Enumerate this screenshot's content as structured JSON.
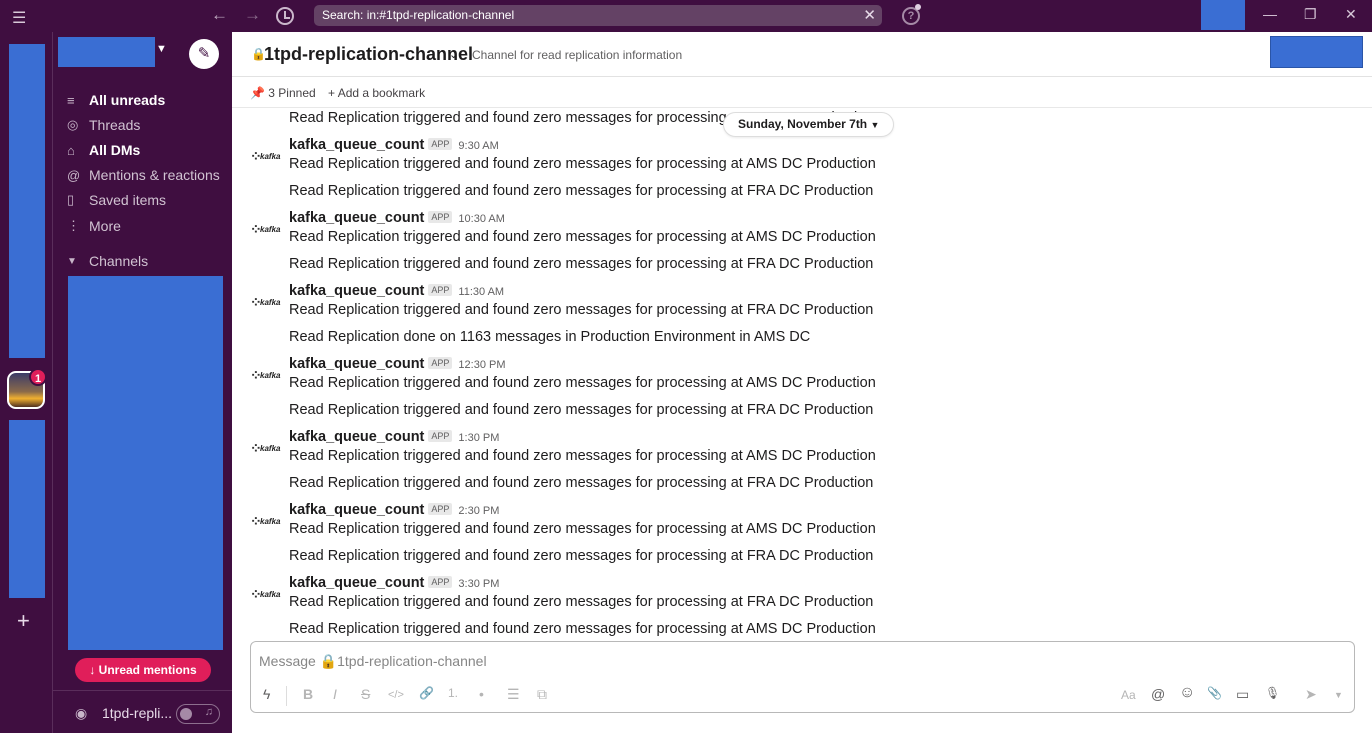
{
  "titlebar": {
    "menu_icon": "hamburger-icon",
    "search_text": "Search: in:#1tpd-replication-channel",
    "help_icon": "?"
  },
  "rail": {
    "workspace_badge": "1"
  },
  "sidebar": {
    "items": [
      {
        "label": "All unreads",
        "icon": "≡",
        "bold": true
      },
      {
        "label": "Threads",
        "icon": "◎",
        "bold": false
      },
      {
        "label": "All DMs",
        "icon": "⌂",
        "bold": true
      },
      {
        "label": "Mentions & reactions",
        "icon": "@",
        "bold": false
      },
      {
        "label": "Saved items",
        "icon": "▯",
        "bold": false
      },
      {
        "label": "More",
        "icon": "⋮",
        "bold": false
      }
    ],
    "channels_label": "Channels",
    "unread_mentions": "Unread mentions",
    "footer_channel": "1tpd-repli..."
  },
  "channel": {
    "name": "1tpd-replication-channel",
    "topic": "Channel for read replication information",
    "pinned": "3 Pinned",
    "add_bookmark": "Add a bookmark",
    "date_divider": "Sunday, November 7th"
  },
  "messages": {
    "top_partial": "Read Replication triggered and found zero messages for processing at FRA DC Production",
    "groups": [
      {
        "author": "kafka_queue_count",
        "badge": "APP",
        "time": "9:30 AM",
        "lines": [
          "Read Replication triggered and found zero messages for processing at AMS DC Production",
          "Read Replication triggered and found zero messages for processing at FRA DC Production"
        ]
      },
      {
        "author": "kafka_queue_count",
        "badge": "APP",
        "time": "10:30 AM",
        "lines": [
          "Read Replication triggered and found zero messages for processing at AMS DC Production",
          "Read Replication triggered and found zero messages for processing at FRA DC Production"
        ]
      },
      {
        "author": "kafka_queue_count",
        "badge": "APP",
        "time": "11:30 AM",
        "lines": [
          "Read Replication triggered and found zero messages for processing at FRA DC Production",
          "Read Replication done on 1163 messages in Production Environment in AMS DC"
        ]
      },
      {
        "author": "kafka_queue_count",
        "badge": "APP",
        "time": "12:30 PM",
        "lines": [
          "Read Replication triggered and found zero messages for processing at AMS DC Production",
          "Read Replication triggered and found zero messages for processing at FRA DC Production"
        ]
      },
      {
        "author": "kafka_queue_count",
        "badge": "APP",
        "time": "1:30 PM",
        "lines": [
          "Read Replication triggered and found zero messages for processing at AMS DC Production",
          "Read Replication triggered and found zero messages for processing at FRA DC Production"
        ]
      },
      {
        "author": "kafka_queue_count",
        "badge": "APP",
        "time": "2:30 PM",
        "lines": [
          "Read Replication triggered and found zero messages for processing at AMS DC Production",
          "Read Replication triggered and found zero messages for processing at FRA DC Production"
        ]
      },
      {
        "author": "kafka_queue_count",
        "badge": "APP",
        "time": "3:30 PM",
        "lines": [
          "Read Replication triggered and found zero messages for processing at FRA DC Production",
          "Read Replication triggered and found zero messages for processing at AMS DC Production"
        ]
      }
    ],
    "avatar_text": "kafka"
  },
  "composer": {
    "placeholder": "Message 🔒1tpd-replication-channel",
    "format_buttons": [
      "B",
      "I",
      "S",
      "</>",
      "🔗",
      "1.",
      "•",
      "☰",
      "⧉"
    ],
    "right_buttons": [
      "Aa",
      "@",
      "☺",
      "📎",
      "▭",
      "🎙"
    ]
  },
  "colors": {
    "aubergine": "#3f0e40",
    "redaction_blue": "#3a6ed3",
    "badge_red": "#e01e5a"
  }
}
